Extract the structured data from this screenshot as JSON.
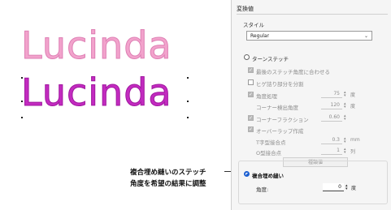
{
  "samples": {
    "top_text": "Lucinda",
    "bottom_text": "Lucinda",
    "top_color": "#f2a3cc",
    "bottom_color": "#c32bc0"
  },
  "panel": {
    "title": "変換値",
    "style_label": "スタイル",
    "style_value": "Regular",
    "turn_stitch_label": "ターンステッチ",
    "options": [
      {
        "label": "最後のステッチ角度に合わせる",
        "checked": true
      },
      {
        "label": "ヒゲ詰り部分を分割",
        "checked": false
      },
      {
        "label": "角度処理",
        "checked": true,
        "value": "75",
        "unit": "度"
      },
      {
        "label": "コーナー検出角度",
        "value": "120",
        "unit": "度"
      },
      {
        "label": "コーナーフラクション",
        "checked": true,
        "value": "0.60"
      },
      {
        "label": "オーバーラップ作成",
        "checked": true
      },
      {
        "label": "T字型接合点",
        "value": "0.3",
        "unit": "mm"
      },
      {
        "label": "O型接合点",
        "value": "1",
        "unit": "列"
      }
    ],
    "split_button": "種類値",
    "complex_fill_label": "複合埋め縫い",
    "angle_label": "角度:",
    "angle_value": "0",
    "angle_unit": "度"
  },
  "callout": {
    "line1": "複合埋め縫いのステッチ",
    "line2": "角度を希望の結果に調整"
  }
}
